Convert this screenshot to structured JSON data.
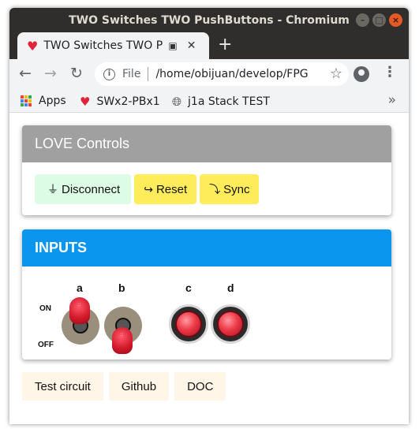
{
  "window": {
    "title": "TWO Switches TWO PushButtons - Chromium"
  },
  "tab": {
    "title": "TWO Switches TWO Pu",
    "new_tab_symbol": "+"
  },
  "toolbar": {
    "back_icon": "←",
    "forward_icon": "→",
    "reload_icon": "↻",
    "omnibox_scheme_label": "File",
    "url": "/home/obijuan/develop/FPG...",
    "star_icon": "☆",
    "menu_icon": "⋮"
  },
  "bookmarks": {
    "items": [
      {
        "label": "Apps",
        "icon": "apps-grid-icon"
      },
      {
        "label": "SWx2-PBx1",
        "icon": "heart-icon"
      },
      {
        "label": "j1a Stack TEST",
        "icon": "globe-icon"
      }
    ],
    "overflow_label": "»"
  },
  "love": {
    "title": "LOVE Controls",
    "buttons": {
      "disconnect": {
        "glyph": "🔌",
        "label": "Disconnect"
      },
      "reset": {
        "glyph": "↪",
        "label": "Reset"
      },
      "sync": {
        "glyph": "⤵",
        "label": "Sync"
      }
    }
  },
  "inputs": {
    "title": "INPUTS",
    "on_label": "ON",
    "off_label": "OFF",
    "switches": [
      {
        "label": "a",
        "state": "on"
      },
      {
        "label": "b",
        "state": "off"
      }
    ],
    "pushbuttons": [
      {
        "label": "c"
      },
      {
        "label": "d"
      }
    ]
  },
  "links": {
    "test_circuit": "Test circuit",
    "github": "Github",
    "doc": "DOC"
  },
  "colors": {
    "inputs_header": "#0a95ee",
    "love_header": "#a0a0a0",
    "disconnect_bg": "#ddfce6",
    "reset_sync_bg": "#ffec5a",
    "link_bg": "#fff6e8",
    "knob_red": "#d31a2c"
  }
}
